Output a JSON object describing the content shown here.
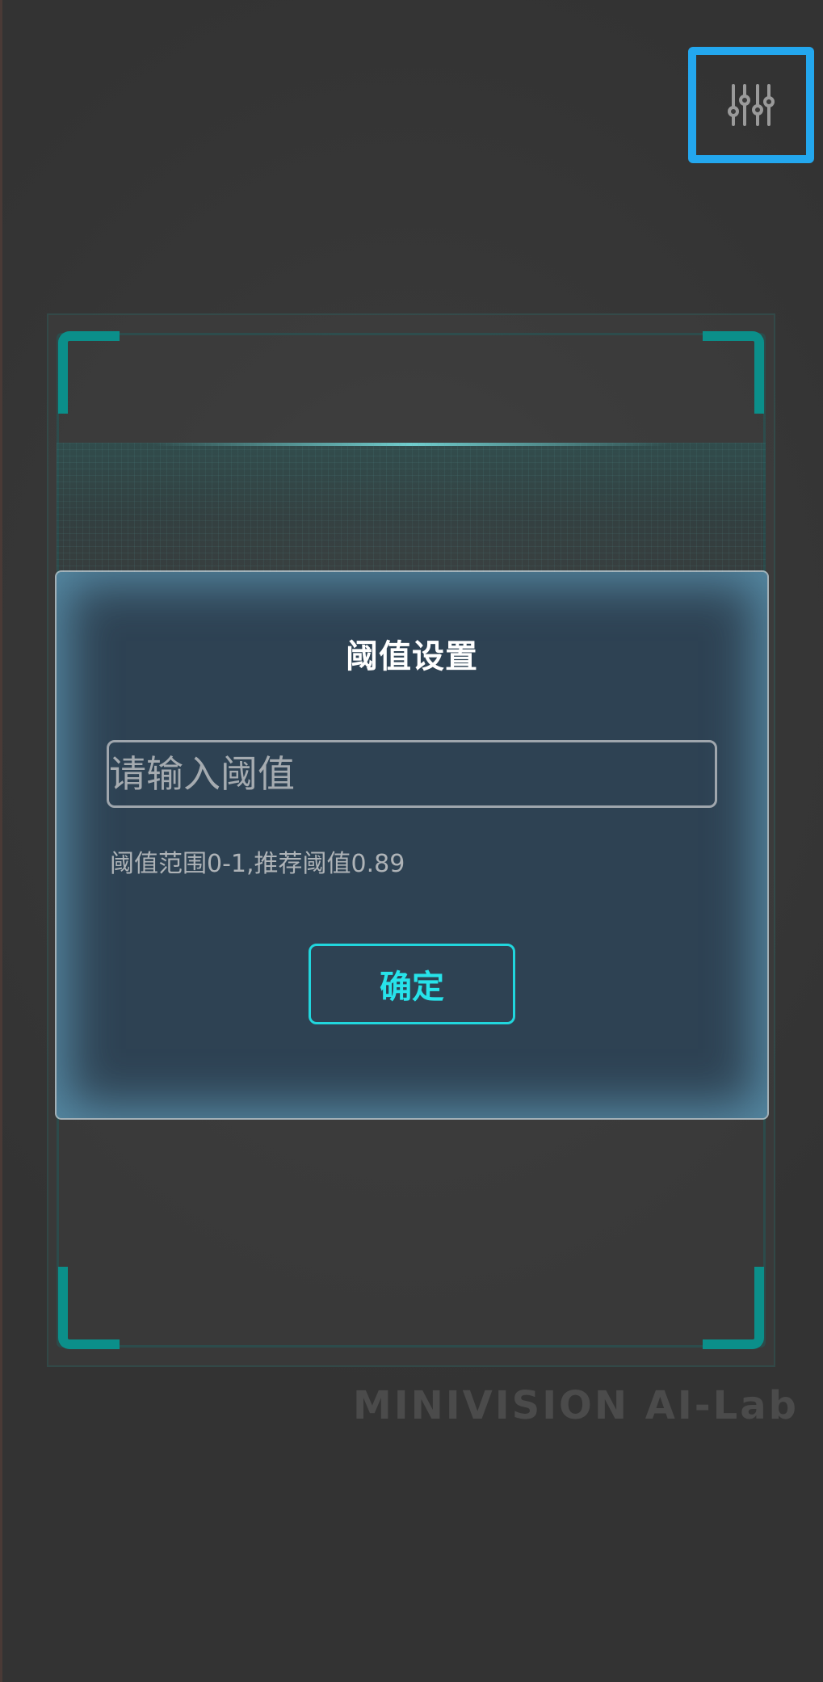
{
  "dialog": {
    "title": "阈值设置",
    "input_placeholder": "请输入阈值",
    "input_value": "",
    "hint": "阈值范围0-1,推荐阈值0.89",
    "confirm_label": "确定"
  },
  "toolbar": {
    "settings_icon": "sliders-icon"
  },
  "watermark": "MINIVISION  AI-Lab",
  "colors": {
    "accent": "#21d6dd",
    "highlight_box": "#23a7ee",
    "dialog_bg": "#2e4253",
    "corner": "#0b8f8a"
  }
}
